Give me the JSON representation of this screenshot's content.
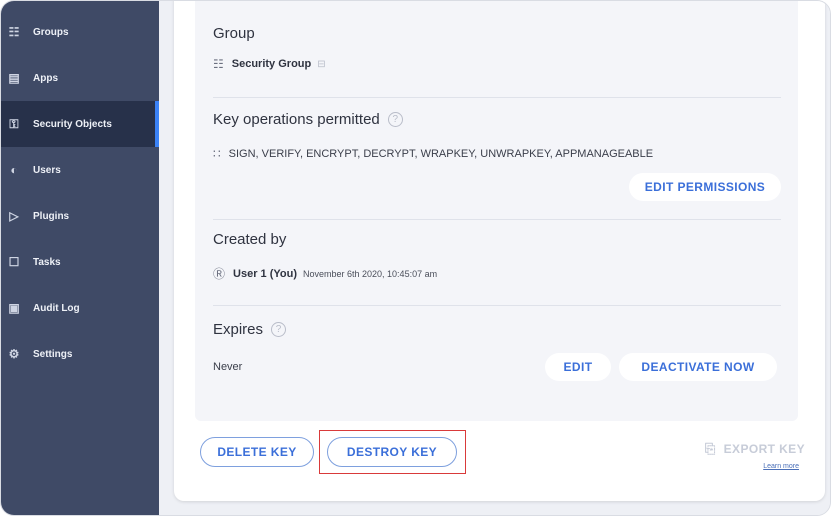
{
  "sidebar": {
    "items": [
      {
        "label": "Groups",
        "icon": "groups-icon"
      },
      {
        "label": "Apps",
        "icon": "apps-icon"
      },
      {
        "label": "Security Objects",
        "icon": "security-objects-icon",
        "active": true
      },
      {
        "label": "Users",
        "icon": "users-icon"
      },
      {
        "label": "Plugins",
        "icon": "plugins-icon"
      },
      {
        "label": "Tasks",
        "icon": "tasks-icon"
      },
      {
        "label": "Audit Log",
        "icon": "audit-log-icon"
      },
      {
        "label": "Settings",
        "icon": "settings-icon"
      }
    ]
  },
  "group": {
    "title": "Group",
    "name": "Security Group"
  },
  "key_operations": {
    "title": "Key operations permitted",
    "list": "SIGN, VERIFY, ENCRYPT, DECRYPT, WRAPKEY, UNWRAPKEY, APPMANAGEABLE",
    "edit_permissions_label": "EDIT PERMISSIONS"
  },
  "created_by": {
    "title": "Created by",
    "user": "User 1 (You)",
    "timestamp": "November 6th 2020, 10:45:07 am"
  },
  "expires": {
    "title": "Expires",
    "value": "Never",
    "edit_label": "EDIT",
    "deactivate_label": "DEACTIVATE NOW"
  },
  "actions": {
    "delete_label": "DELETE KEY",
    "destroy_label": "DESTROY KEY",
    "export_label": "EXPORT KEY",
    "learn_more": "Learn more"
  },
  "colors": {
    "sidebar": "#3f4a66",
    "accent": "#3b6fd9",
    "highlight": "#d93a3a"
  }
}
